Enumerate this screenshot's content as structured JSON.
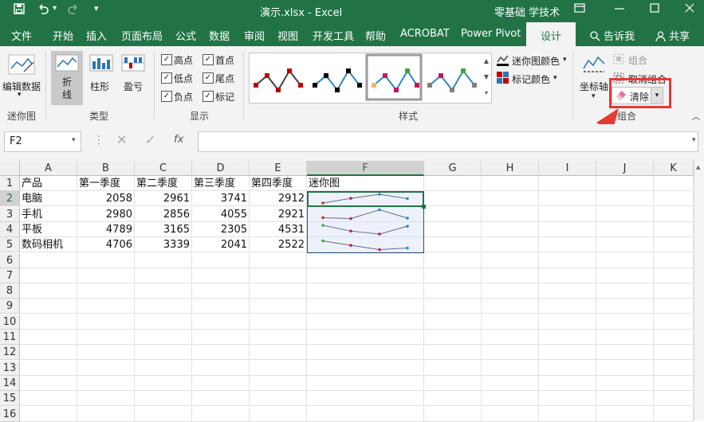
{
  "window": {
    "title": "演示.xlsx  -  Excel",
    "account": "零基础 学技术"
  },
  "menu": {
    "tabs": [
      "文件",
      "开始",
      "插入",
      "页面布局",
      "公式",
      "数据",
      "审阅",
      "视图",
      "开发工具",
      "帮助",
      "ACROBAT",
      "Power Pivot",
      "设计"
    ],
    "active": "设计",
    "tell_me": "告诉我",
    "share": "共享"
  },
  "ribbon": {
    "sparkline_group": {
      "label": "迷你图",
      "edit_data": "编辑数据"
    },
    "type_group": {
      "label": "类型",
      "line": "折\n线",
      "line_a": "折",
      "line_b": "线",
      "column": "柱形",
      "win_loss": "盈亏"
    },
    "show_group": {
      "label": "显示",
      "checks": [
        {
          "label": "高点",
          "checked": true
        },
        {
          "label": "首点",
          "checked": true
        },
        {
          "label": "低点",
          "checked": true
        },
        {
          "label": "尾点",
          "checked": true
        },
        {
          "label": "负点",
          "checked": true
        },
        {
          "label": "标记",
          "checked": true
        }
      ]
    },
    "style_group": {
      "label": "样式",
      "sparkline_color": "迷你图颜色",
      "marker_color": "标记颜色"
    },
    "group_group": {
      "label": "组合",
      "axis": "坐标轴",
      "group": "组合",
      "ungroup": "取消组合",
      "clear": "清除"
    }
  },
  "formula_bar": {
    "name_box": "F2",
    "fx": "fx",
    "formula": ""
  },
  "sheet": {
    "columns": [
      "A",
      "B",
      "C",
      "D",
      "E",
      "F",
      "G",
      "H",
      "I",
      "J",
      "K"
    ],
    "rows": [
      "1",
      "2",
      "3",
      "4",
      "5",
      "6",
      "7",
      "8",
      "9",
      "10",
      "11",
      "12",
      "13",
      "14",
      "15",
      "16"
    ],
    "headers": [
      "产品",
      "第一季度",
      "第二季度",
      "第三季度",
      "第四季度",
      "迷你图"
    ],
    "data": [
      {
        "product": "电脑",
        "q": [
          2058,
          2961,
          3741,
          2912
        ]
      },
      {
        "product": "手机",
        "q": [
          2980,
          2856,
          4055,
          2921
        ]
      },
      {
        "product": "平板",
        "q": [
          4789,
          3165,
          2305,
          4531
        ]
      },
      {
        "product": "数码相机",
        "q": [
          4706,
          3339,
          2041,
          2522
        ]
      }
    ]
  },
  "colors": {
    "excel_green": "#217346",
    "highlight_red": "#e53935",
    "sparkline_line": "#6a6a8a",
    "marker_red": "#d32f2f",
    "marker_pink": "#c2185b",
    "marker_blue": "#2e86c1",
    "marker_green": "#43a047"
  }
}
